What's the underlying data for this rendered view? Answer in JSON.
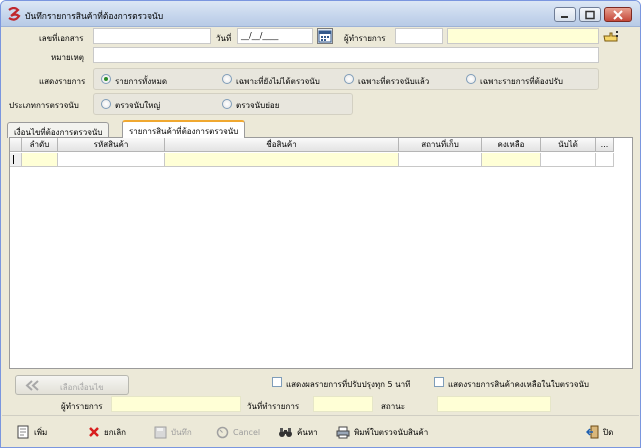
{
  "window": {
    "title": "บันทึกรายการสินค้าที่ต้องการตรวจนับ"
  },
  "form": {
    "doc_no_label": "เลขที่เอกสาร",
    "doc_no_value": "",
    "date_label": "วันที่",
    "date_value": "__/__/____",
    "creator_label": "ผู้ทำรายการ",
    "creator_value": "",
    "note_label": "หมายเหตุ",
    "note_value": "",
    "show_label": "แสดงรายการ",
    "show_options": [
      "รายการทั้งหมด",
      "เฉพาะที่ยังไม่ได้ตรวจนับ",
      "เฉพาะที่ตรวจนับแล้ว",
      "เฉพาะรายการที่ต้องปรับ"
    ],
    "count_type_label": "ประเภทการตรวจนับ",
    "count_type_options": [
      "ตรวจนับใหญ่",
      "ตรวจนับย่อย"
    ]
  },
  "tabs": [
    "เงื่อนไขที่ต้องการตรวจนับ",
    "รายการสินค้าที่ต้องการตรวจนับ"
  ],
  "grid": {
    "headers": [
      "ลำดับ",
      "รหัสสินค้า",
      "ชื่อสินค้า",
      "สถานที่เก็บ",
      "คงเหลือ",
      "นับได้",
      "..."
    ]
  },
  "footer": {
    "select_condition_label": "เลือกเงื่อนไข",
    "auto_refresh_label": "แสดงผลรายการที่ปรับปรุงทุก 5 นาที",
    "show_remaining_label": "แสดงรายการสินค้าคงเหลือในใบตรวจนับ",
    "creator_label": "ผู้ทำรายการ",
    "created_date_label": "วันที่ทำรายการ",
    "status_label": "สถานะ"
  },
  "toolbar": {
    "add": "เพิ่ม",
    "cancel_item": "ยกเลิก",
    "save": "บันทึก",
    "cancel": "Cancel",
    "search": "ค้นหา",
    "print": "พิมพ์ใบตรวจนับสินค้า",
    "close": "ปิด"
  },
  "colors": {
    "accent": "#f0a830",
    "field_yellow": "#ffffd6",
    "title_bg": "#c5d5ec"
  }
}
